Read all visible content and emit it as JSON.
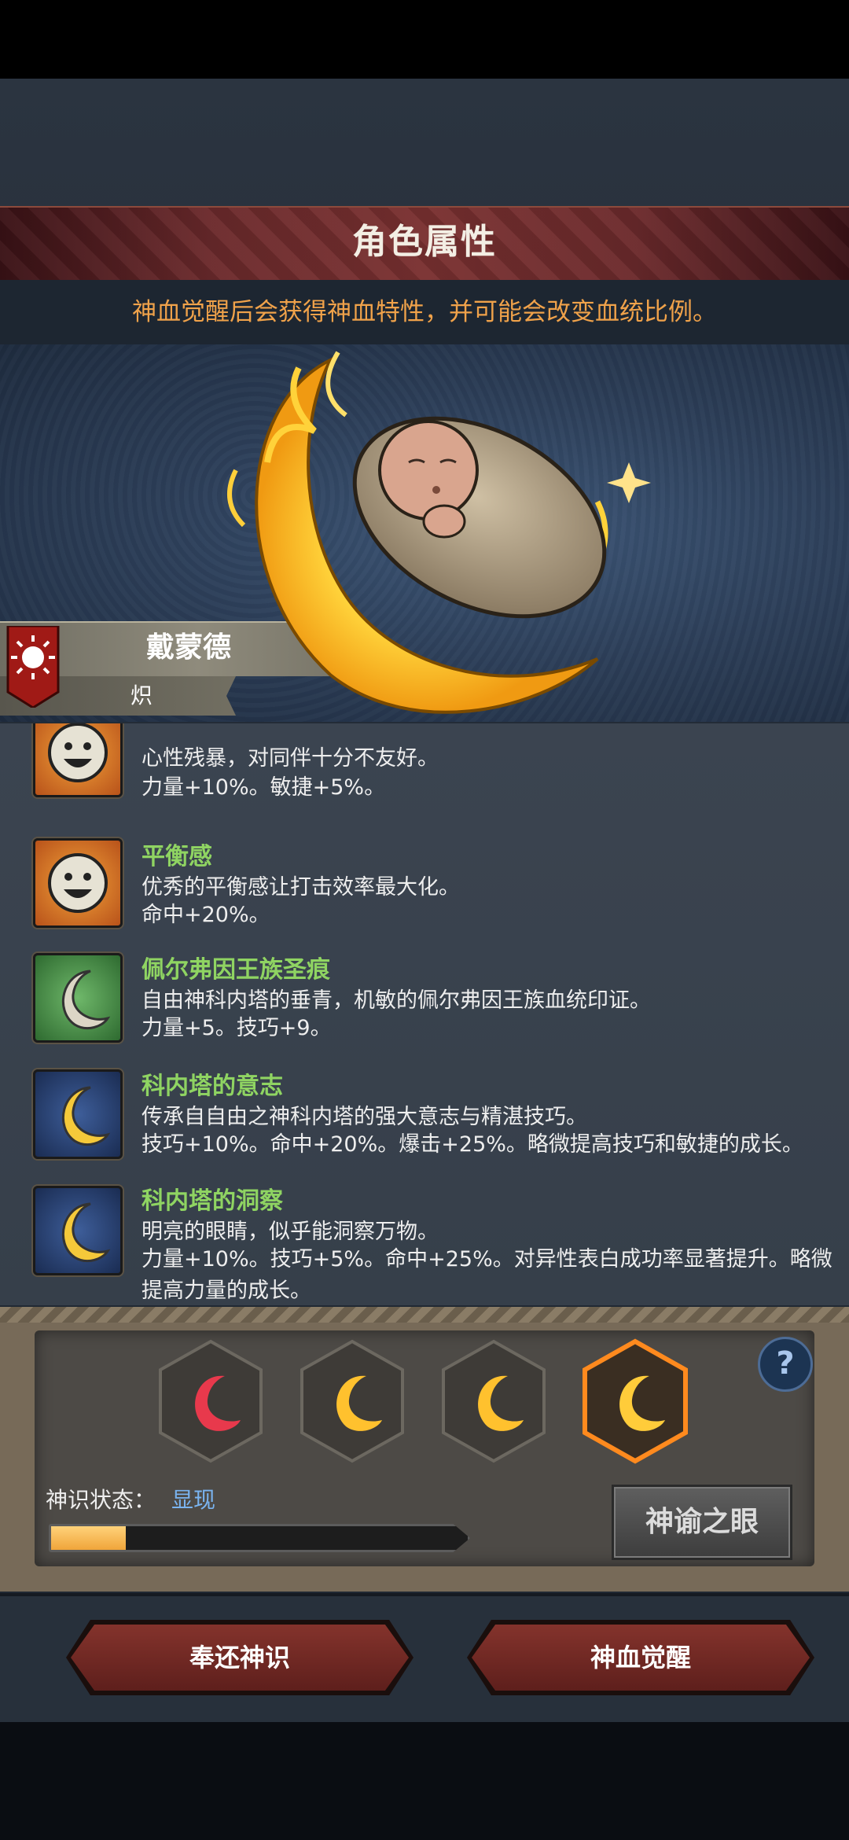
{
  "header": {
    "title": "角色属性",
    "subtitle": "神血觉醒后会获得神血特性，并可能会改变血统比例。"
  },
  "character": {
    "name": "戴蒙德",
    "tag": "炽"
  },
  "traits": [
    {
      "name": "",
      "icon": "smiley-face-icon",
      "description": "心性残暴，对同伴十分不友好。",
      "effect": "力量+10%。敏捷+5%。"
    },
    {
      "name": "平衡感",
      "icon": "smiley-face-icon",
      "description": "优秀的平衡感让打击效率最大化。",
      "effect": "命中+20%。"
    },
    {
      "name": "佩尔弗因王族圣痕",
      "icon": "silver-crescent-icon",
      "description": "自由神科内塔的垂青，机敏的佩尔弗因王族血统印证。",
      "effect": "力量+5。技巧+9。"
    },
    {
      "name": "科内塔的意志",
      "icon": "golden-crescent-icon",
      "description": "传承自自由之神科内塔的强大意志与精湛技巧。",
      "effect": "技巧+10%。命中+20%。爆击+25%。略微提高技巧和敏捷的成长。"
    },
    {
      "name": "科内塔的洞察",
      "icon": "golden-crescent-icon",
      "description": "明亮的眼睛，似乎能洞察万物。",
      "effect": "力量+10%。技巧+5%。命中+25%。对异性表白成功率显著提升。略微提高力量的成长。"
    }
  ],
  "divinity": {
    "status_label": "神识状态：",
    "status_value": "显现",
    "progress": 0.18,
    "oracle_button": "神谕之眼",
    "help": "?",
    "slots": [
      {
        "icon": "red-crescent-icon",
        "state": "red"
      },
      {
        "icon": "gold-crescent-icon",
        "state": "gold"
      },
      {
        "icon": "gold-crescent-icon",
        "state": "gold"
      },
      {
        "icon": "gold-crescent-icon",
        "state": "selected"
      }
    ]
  },
  "actions": {
    "return_label": "奉还神识",
    "awaken_label": "神血觉醒"
  },
  "colors": {
    "trait_name": "#8fd462",
    "subtitle": "#f0a24a",
    "status_value": "#7ab4f0",
    "button_red": "#84332c"
  }
}
